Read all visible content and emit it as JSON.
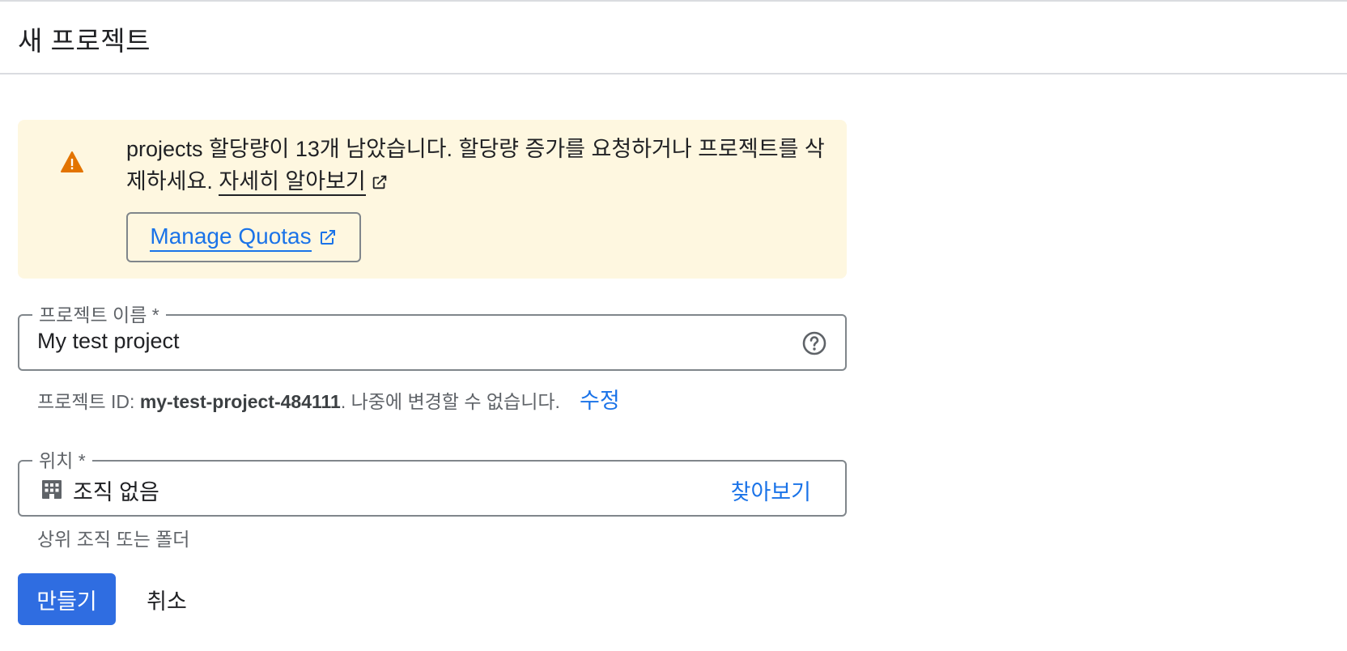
{
  "header": {
    "title": "새 프로젝트"
  },
  "quota_banner": {
    "message": "projects 할당량이 13개 남았습니다. 할당량 증가를 요청하거나 프로젝트를 삭제하세요.",
    "learn_more": "자세히 알아보기",
    "manage_button": "Manage Quotas",
    "icon": "warning-icon",
    "accent_color": "#e37400"
  },
  "project_name": {
    "label": "프로젝트 이름 *",
    "value": "My test project",
    "help_icon": "help-circle-icon"
  },
  "project_id": {
    "prefix": "프로젝트 ID: ",
    "id": "my-test-project-484111",
    "suffix": ". 나중에 변경할 수 없습니다.",
    "edit_label": "수정"
  },
  "location": {
    "label": "위치 *",
    "value": "조직 없음",
    "icon": "organization-icon",
    "browse_label": "찾아보기",
    "hint": "상위 조직 또는 폴더"
  },
  "actions": {
    "create_label": "만들기",
    "cancel_label": "취소",
    "primary_color": "#2f6de1"
  }
}
